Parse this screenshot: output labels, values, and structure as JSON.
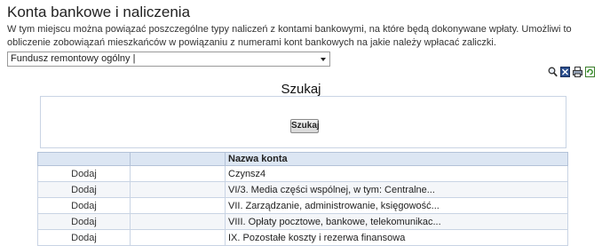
{
  "header": {
    "title": "Konta bankowe i naliczenia",
    "description": "W tym miejscu można powiązać poszczególne typy naliczeń z kontami bankowymi, na które będą dokonywane wpłaty. Umożliwi to obliczenie zobowiązań mieszkańców w powiązaniu z numerami kont bankowych na jakie należy wpłacać zaliczki."
  },
  "fund_select": {
    "value": "Fundusz remontowy ogólny |"
  },
  "toolbar": {
    "icons": [
      "search-icon",
      "excel-icon",
      "print-icon",
      "refresh-icon"
    ]
  },
  "search": {
    "title": "Szukaj",
    "button_label": "Szukaj"
  },
  "table": {
    "columns": [
      "",
      "",
      "Nazwa konta"
    ],
    "rows": [
      {
        "action": "Dodaj",
        "name": "Czynsz4"
      },
      {
        "action": "Dodaj",
        "name": "VI/3. Media części wspólnej, w tym: Centralne..."
      },
      {
        "action": "Dodaj",
        "name": "VII. Zarządzanie, administrowanie, księgowość..."
      },
      {
        "action": "Dodaj",
        "name": "VIII. Opłaty pocztowe, bankowe, telekomunikac..."
      },
      {
        "action": "Dodaj",
        "name": "IX. Pozostałe koszty i rezerwa finansowa"
      }
    ]
  },
  "colors": {
    "header_bg": "#dce6f3",
    "border": "#c9d4e4"
  }
}
